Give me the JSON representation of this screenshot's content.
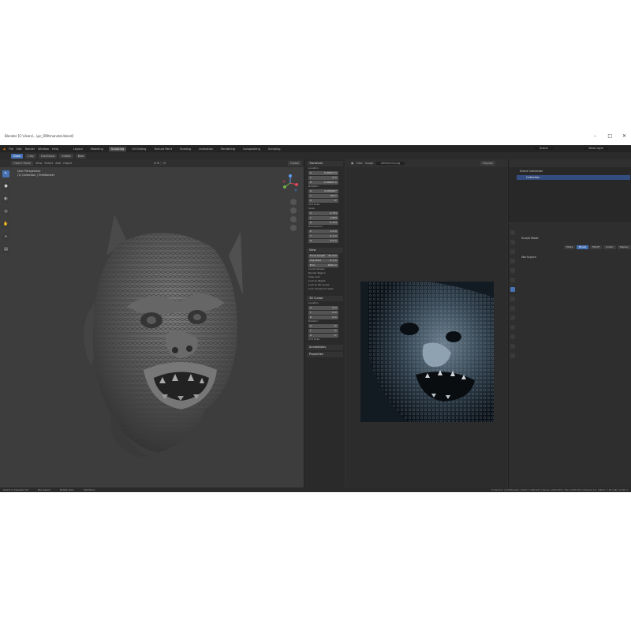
{
  "window": {
    "title": "Blender [C:\\Users\\...\\pc_ORKmonster.blend]"
  },
  "menu": {
    "items": [
      "File",
      "Edit",
      "Render",
      "Window",
      "Help"
    ],
    "workspaces": [
      "Layout",
      "Modeling",
      "Sculpting",
      "UV Editing",
      "Texture Paint",
      "Shading",
      "Animation",
      "Rendering",
      "Compositing",
      "Scripting"
    ],
    "active_workspace": "Sculpting",
    "scene": "Scene",
    "view_layer": "View Layer"
  },
  "modebar": {
    "items": [
      "Draw",
      "Clay",
      "ClayStrips",
      "Inflate",
      "Blob"
    ]
  },
  "viewport": {
    "header": [
      "Object Mode",
      "View",
      "Select",
      "Add",
      "Object"
    ],
    "info_line1": "User Perspective",
    "info_line2": "(1) Collection | OrkMonster",
    "shading": "Global"
  },
  "npanel": {
    "transform": "Transform",
    "location": "Location",
    "rotation": "Rotation",
    "scale": "Scale",
    "dimensions": "Dimensions",
    "xyz_euler": "XYZ Euler",
    "loc": [
      {
        "axis": "X",
        "value": "0.00005 m"
      },
      {
        "axis": "Y",
        "value": "0 m"
      },
      {
        "axis": "Z",
        "value": "0.10906 m"
      }
    ],
    "rot": [
      {
        "axis": "X",
        "value": "0.000042°"
      },
      {
        "axis": "Y",
        "value": "90.2°"
      },
      {
        "axis": "Z",
        "value": "0°"
      }
    ],
    "scl": [
      {
        "axis": "X",
        "value": "0.731"
      },
      {
        "axis": "Y",
        "value": "0.699"
      },
      {
        "axis": "Z",
        "value": "0.731"
      }
    ],
    "dim": [
      {
        "axis": "X",
        "value": "1.2 m"
      },
      {
        "axis": "Y",
        "value": "0.1 m"
      },
      {
        "axis": "Z",
        "value": "0.5 m"
      }
    ],
    "view": "View",
    "focal_length_label": "Focal Length",
    "focal_length": "50 mm",
    "clip_start_label": "Clip Start",
    "clip_start": "0.1 m",
    "clip_end_label": "End",
    "clip_end": "1000 m",
    "local_camera": "Local Camera",
    "render_region": "Render Region",
    "view_lock": "View Lock",
    "lock_to_object": "Lock to Object",
    "lock_3d_cursor": "Lock to 3D Cursor",
    "lock_camera": "Lock Camera to View",
    "cursor": "3D Cursor",
    "cursor_location": "Location",
    "cur_loc": [
      {
        "axis": "X",
        "value": "0 m"
      },
      {
        "axis": "Y",
        "value": "0 m"
      },
      {
        "axis": "Z",
        "value": "0 m"
      }
    ],
    "cursor_rotation": "Rotation",
    "cur_rot": [
      {
        "axis": "X",
        "value": "0°"
      },
      {
        "axis": "Y",
        "value": "0°"
      },
      {
        "axis": "Z",
        "value": "0°"
      }
    ],
    "annotations": "Annotations",
    "properties": "Properties"
  },
  "image_editor": {
    "header": [
      "View",
      "Image"
    ],
    "image_name": "reference.png",
    "slot": "Display"
  },
  "outliner": {
    "title": "Scene Collection",
    "items": [
      "Collection"
    ]
  },
  "properties": {
    "tabs": [
      "Mode",
      "Brush",
      "Falloff",
      "Cursor",
      "Display"
    ],
    "active_tab": "Brush",
    "label": "Sculpt Mode",
    "workspace": "Workspace"
  },
  "statusbar": {
    "left": [
      "Select or Deselect All",
      "Box Select",
      "Rotate View",
      "Call Menu"
    ],
    "right": "Collection | OrkMonster | Verts 1,026,097 | Faces 1,024,002 | Tris 2,048,004 | Objects 1/1 | Mem: 1.81 GiB | v2.90.1"
  },
  "colors": {
    "accent": "#4772b3",
    "bg": "#303030"
  }
}
